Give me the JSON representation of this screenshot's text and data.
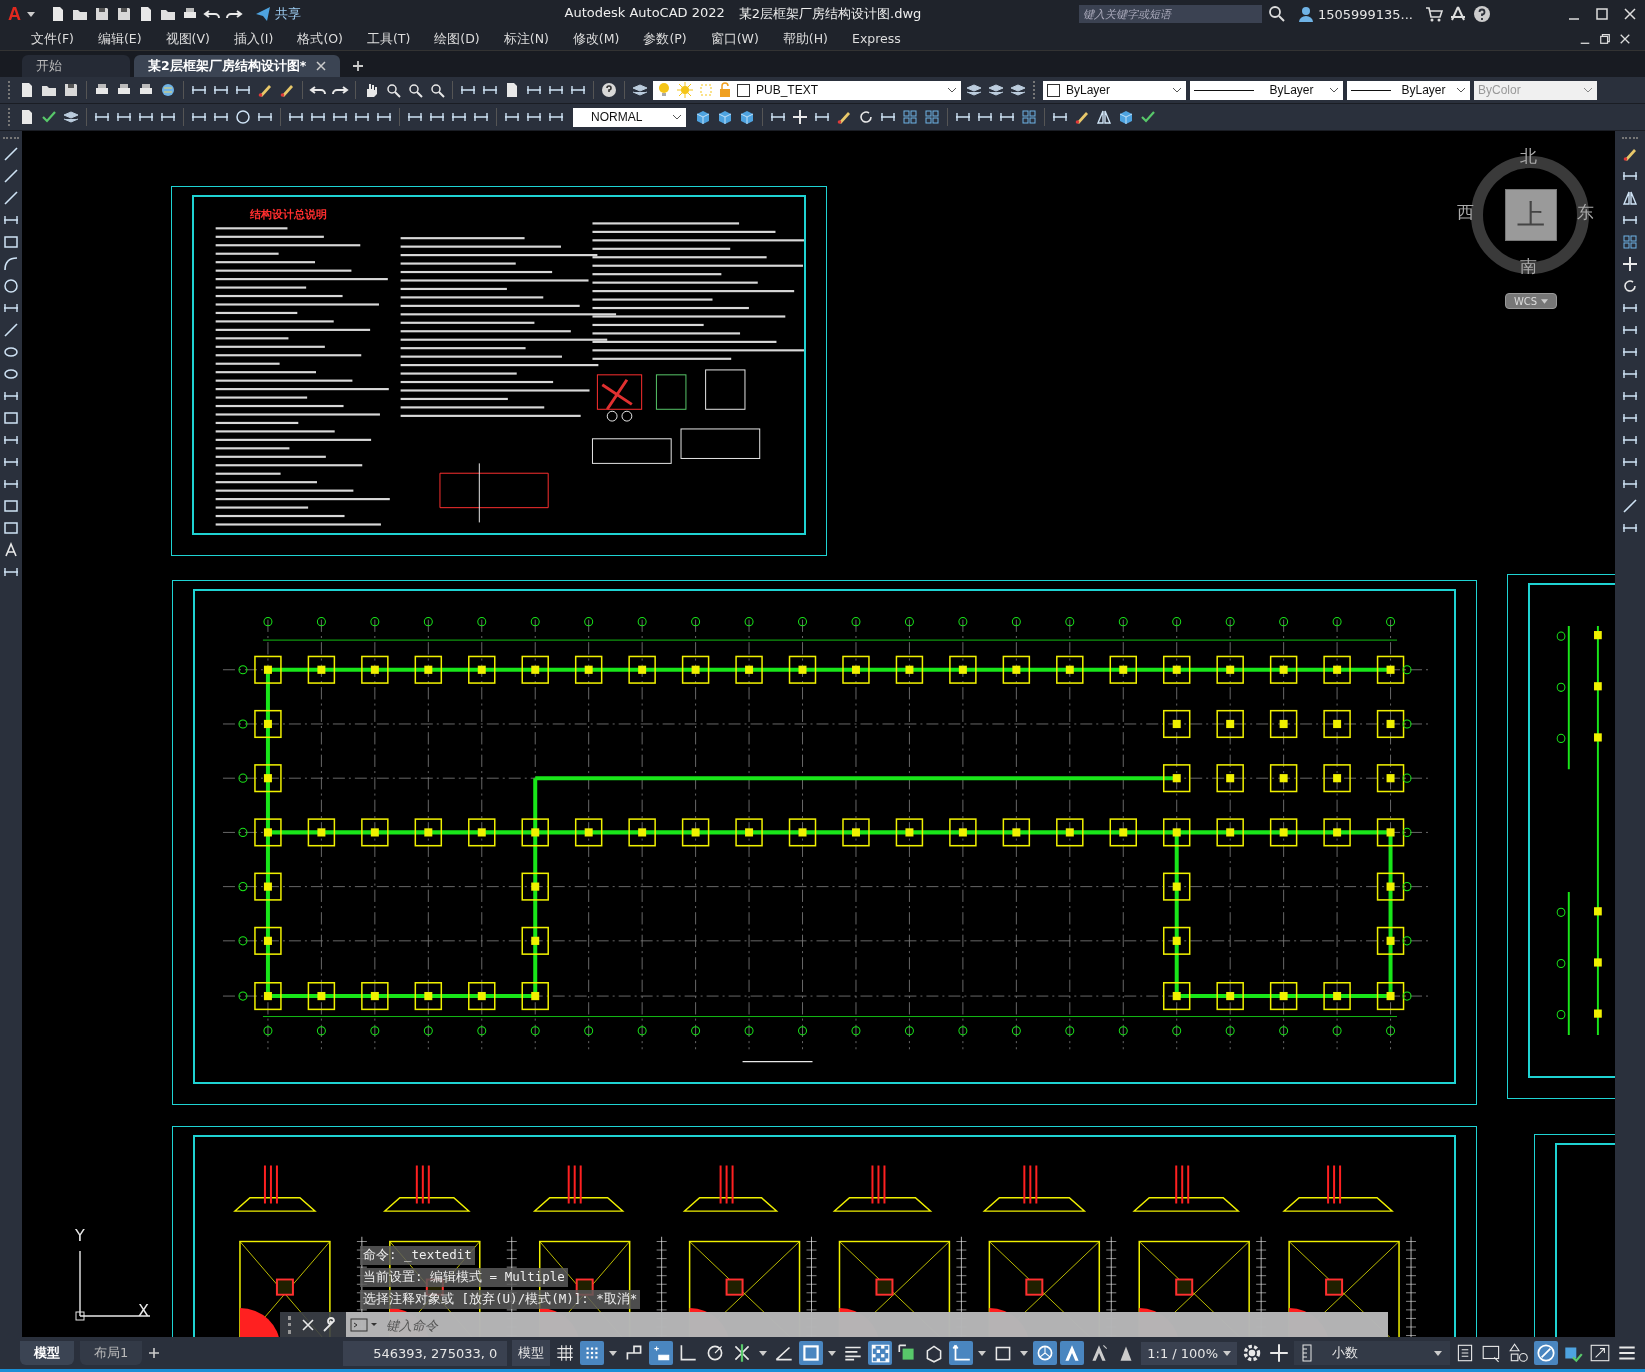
{
  "title_bar": {
    "logo": "A",
    "share": "共享",
    "app": "Autodesk AutoCAD 2022",
    "file": "某2层框架厂房结构设计图.dwg",
    "search": {
      "placeholder": "键入关键字或短语"
    },
    "user": "1505999135..."
  },
  "menu": [
    "文件(F)",
    "编辑(E)",
    "视图(V)",
    "插入(I)",
    "格式(O)",
    "工具(T)",
    "绘图(D)",
    "标注(N)",
    "修改(M)",
    "参数(P)",
    "窗口(W)",
    "帮助(H)",
    "Express"
  ],
  "doc_tabs": [
    {
      "label": "开始",
      "selected": false
    },
    {
      "label": "某2层框架厂房结构设计图*",
      "selected": true
    }
  ],
  "properties": {
    "layer": "PUB_TEXT",
    "color_setting": "ByLayer",
    "linetype": "ByLayer",
    "lineweight": "ByLayer",
    "plot_style": {
      "value": "ByColor",
      "disabled": true
    }
  },
  "dim_style": "NORMAL",
  "viewcube": {
    "north": "北",
    "west": "西",
    "face": "上",
    "east": "东",
    "south": "南",
    "ucs": "WCS"
  },
  "sheets": [
    {
      "title": "结构设计总说明"
    }
  ],
  "ucs_icon": {
    "y": "Y",
    "x": "X"
  },
  "command_history": [
    "命令: _textedit",
    "当前设置: 编辑模式 = Multiple",
    "选择注释对象或 [放弃(U)/模式(M)]: *取消*"
  ],
  "command_line": {
    "placeholder": "键入命令"
  },
  "layout_tabs": [
    {
      "label": "模型",
      "selected": true
    },
    {
      "label": "布局1",
      "selected": false
    }
  ],
  "status_bar": {
    "coordinates": "546393, 275033, 0",
    "space": "模型",
    "scale": "1:1 / 100%",
    "units": "小数",
    "toggles": [
      {
        "kind": "grid",
        "on": false
      },
      {
        "kind": "snap",
        "on": true
      },
      {
        "kind": "infer",
        "on": false
      },
      {
        "kind": "dynamic",
        "on": true
      },
      {
        "kind": "ortho",
        "on": false
      },
      {
        "kind": "polar",
        "on": false
      },
      {
        "kind": "osnap",
        "on": false
      },
      {
        "kind": "angle",
        "on": false
      },
      {
        "kind": "otrack",
        "on": true
      },
      {
        "kind": "lineweight",
        "on": false
      },
      {
        "kind": "transparency",
        "on": true
      },
      {
        "kind": "cycling",
        "on": false
      },
      {
        "kind": "osnap3d",
        "on": false
      },
      {
        "kind": "ucs",
        "on": true
      },
      {
        "kind": "filter",
        "on": false
      },
      {
        "kind": "gizmo",
        "on": true
      },
      {
        "kind": "annovis",
        "on": true
      },
      {
        "kind": "autoscale",
        "on": false
      },
      {
        "kind": "annoscale",
        "on": false
      }
    ]
  }
}
